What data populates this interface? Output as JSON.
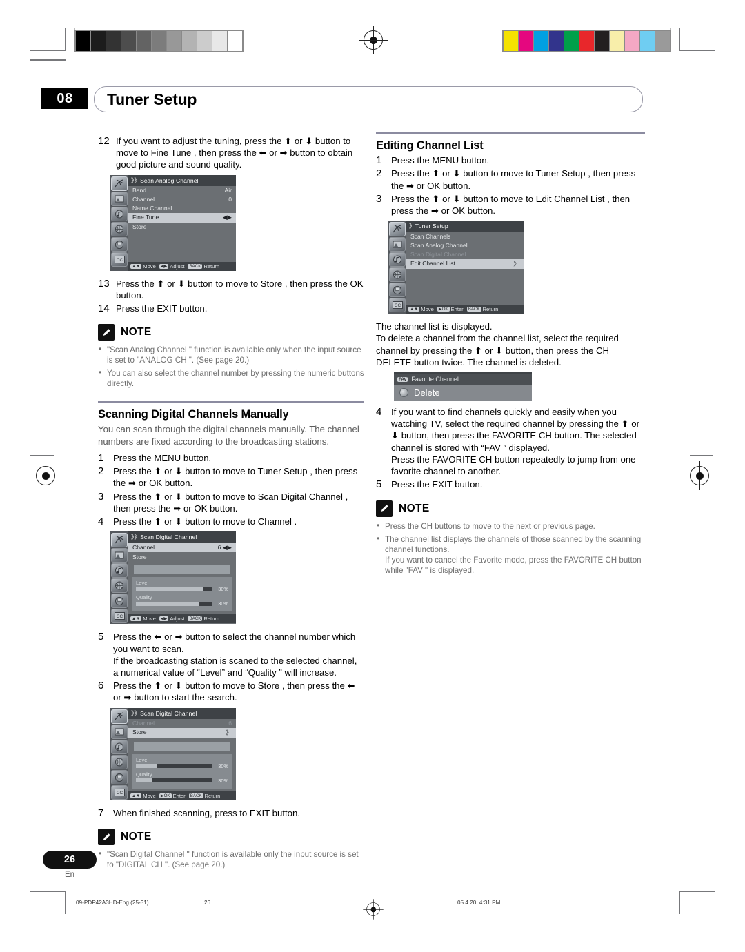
{
  "header": {
    "chapter": "08",
    "title": "Tuner Setup"
  },
  "printer_marks": {
    "grayscale_swatches": [
      "#000000",
      "#1c1c1c",
      "#333333",
      "#4d4d4d",
      "#636363",
      "#7c7c7c",
      "#989898",
      "#b3b3b3",
      "#cccccc",
      "#e8e8e8",
      "#ffffff"
    ],
    "color_swatches": [
      "#f5e200",
      "#e5077f",
      "#00a0e2",
      "#32348c",
      "#00a04a",
      "#e8272b",
      "#231f20",
      "#f8eeaa",
      "#f4a8c4",
      "#6fcdf2",
      "#9a9a9a"
    ]
  },
  "left_column": {
    "steps_continued": [
      {
        "n": "12",
        "text": "If you want to adjust the tuning, press the ⬆ or ⬇ button to move to Fine Tune , then press the ⬅ or ➡ button to obtain good picture and sound quality."
      }
    ],
    "osd_analog": {
      "title": "Scan Analog Channel",
      "title_prefix": "》》",
      "items": [
        {
          "label": "Band",
          "value": "Air",
          "state": "normal"
        },
        {
          "label": "Channel",
          "value": "0",
          "state": "normal"
        },
        {
          "label": "Name Channel",
          "value": "",
          "state": "normal"
        },
        {
          "label": "Fine Tune",
          "value": "◀▶",
          "state": "highlight"
        },
        {
          "label": "Store",
          "value": "",
          "state": "normal"
        }
      ],
      "footer": [
        {
          "key": "▲▼",
          "label": "Move"
        },
        {
          "key": "◀▶",
          "label": "Adjust"
        },
        {
          "key": "BACK",
          "label": "Return"
        }
      ],
      "icons": [
        "antenna-icon",
        "picture-icon",
        "sound-icon",
        "setup-icon",
        "install-icon",
        "cc-icon"
      ]
    },
    "steps_after_analog": [
      {
        "n": "13",
        "text": "Press the ⬆ or ⬇ button to move to Store , then press the OK button."
      },
      {
        "n": "14",
        "text": "Press the EXIT button."
      }
    ],
    "note_analog": {
      "label": "NOTE",
      "items": [
        "\"Scan Analog Channel \" function is available only when the input source is set to \"ANALOG CH \". (See page 20.)",
        "You can also select the channel number by pressing the numeric buttons directly."
      ]
    },
    "section": {
      "heading": "Scanning Digital Channels Manually",
      "intro": "You can scan through the digital channels manually. The channel numbers are fixed according to the broadcasting stations.",
      "steps": [
        {
          "n": "1",
          "text": "Press the MENU button."
        },
        {
          "n": "2",
          "text": "Press the ⬆ or ⬇ button to move to Tuner Setup , then press the ➡ or OK button."
        },
        {
          "n": "3",
          "text": "Press the ⬆ or ⬇ button to move to Scan Digital Channel , then press the ➡ or OK button."
        },
        {
          "n": "4",
          "text": "Press the ⬆ or ⬇ button to move to Channel ."
        }
      ]
    },
    "osd_digital_1": {
      "title": "Scan Digital Channel",
      "title_prefix": "》》",
      "items": [
        {
          "label": "Channel",
          "value": "6 ◀▶",
          "state": "highlight"
        },
        {
          "label": "Store",
          "value": "",
          "state": "normal"
        }
      ],
      "level_label": "Level",
      "level_value": "30%",
      "level_pct": 88,
      "quality_label": "Quality",
      "quality_value": "30%",
      "quality_pct": 84,
      "footer": [
        {
          "key": "▲▼",
          "label": "Move"
        },
        {
          "key": "◀▶",
          "label": "Adjust"
        },
        {
          "key": "BACK",
          "label": "Return"
        }
      ]
    },
    "steps_mid": [
      {
        "n": "5",
        "text": "Press the ⬅ or ➡ button to select the channel number which you want to scan.\nIf the broadcasting station is scaned to the selected channel, a numerical value of “Level” and “Quality ” will increase."
      },
      {
        "n": "6",
        "text": "Press the ⬆ or ⬇ button to move to Store , then press the ⬅ or ➡ button to start the search."
      }
    ],
    "osd_digital_2": {
      "title": "Scan Digital Channel",
      "title_prefix": "》》",
      "items": [
        {
          "label": "Channel",
          "value": "6",
          "state": "dim"
        },
        {
          "label": "Store",
          "value": "》",
          "state": "highlight"
        }
      ],
      "level_label": "Level",
      "level_value": "30%",
      "level_pct": 28,
      "quality_label": "Quality",
      "quality_value": "30%",
      "quality_pct": 22,
      "footer": [
        {
          "key": "▲▼",
          "label": "Move"
        },
        {
          "key": "▶OK",
          "label": "Enter"
        },
        {
          "key": "BACK",
          "label": "Return"
        }
      ]
    },
    "steps_end": [
      {
        "n": "7",
        "text": "When finished scanning, press to EXIT button."
      }
    ],
    "note_digital": {
      "label": "NOTE",
      "items": [
        "\"Scan Digital Channel \" function is available only the input source is set to \"DIGITAL CH \". (See page 20.)"
      ]
    }
  },
  "right_column": {
    "section": {
      "heading": "Editing Channel List",
      "steps": [
        {
          "n": "1",
          "text": "Press the MENU button."
        },
        {
          "n": "2",
          "text": "Press the ⬆ or ⬇ button to move to Tuner Setup , then press the ➡ or OK button."
        },
        {
          "n": "3",
          "text": "Press the ⬆ or ⬇ button to move to Edit Channel List , then press the ➡ or OK button."
        }
      ]
    },
    "osd_tuner": {
      "title": "Tuner Setup",
      "title_prefix": "》",
      "items": [
        {
          "label": "Scan Channels",
          "value": "",
          "state": "normal"
        },
        {
          "label": "Scan Analog Channel",
          "value": "",
          "state": "normal"
        },
        {
          "label": "Scan Digital Channel",
          "value": "",
          "state": "dim"
        },
        {
          "label": "Edit Channel List",
          "value": "》",
          "state": "highlight"
        }
      ],
      "footer": [
        {
          "key": "▲▼",
          "label": "Move"
        },
        {
          "key": "▶OK",
          "label": "Enter"
        },
        {
          "key": "BACK",
          "label": "Return"
        }
      ]
    },
    "paragraph": "The channel list is displayed.\nTo delete a channel from the channel list, select the required channel by pressing the ⬆ or ⬇ button, then press the CH DELETE button twice. The channel is deleted.",
    "fav_panel": {
      "tag": "FAV",
      "title": "Favorite Channel",
      "action": "Delete"
    },
    "steps_after": [
      {
        "n": "4",
        "text": "If you want to find channels quickly and easily when you watching TV, select the required channel by pressing the ⬆ or ⬇ button, then press the FAVORITE CH button. The selected channel is stored with “FAV ” displayed.\nPress the FAVORITE CH button repeatedly to jump from one favorite channel to another."
      },
      {
        "n": "5",
        "text": "Press the EXIT button."
      }
    ],
    "note": {
      "label": "NOTE",
      "items": [
        "Press the CH buttons to move to the next or previous page.",
        "The channel list displays the channels of those scanned by the scanning channel functions.\nIf you want to cancel the Favorite mode, press the FAVORITE CH button while \"FAV \" is displayed."
      ]
    }
  },
  "footer": {
    "page_number": "26",
    "language": "En",
    "job": "09-PDP42A3HD-Eng (25-31)",
    "folio": "26",
    "timestamp": "05.4.20, 4:31 PM"
  }
}
